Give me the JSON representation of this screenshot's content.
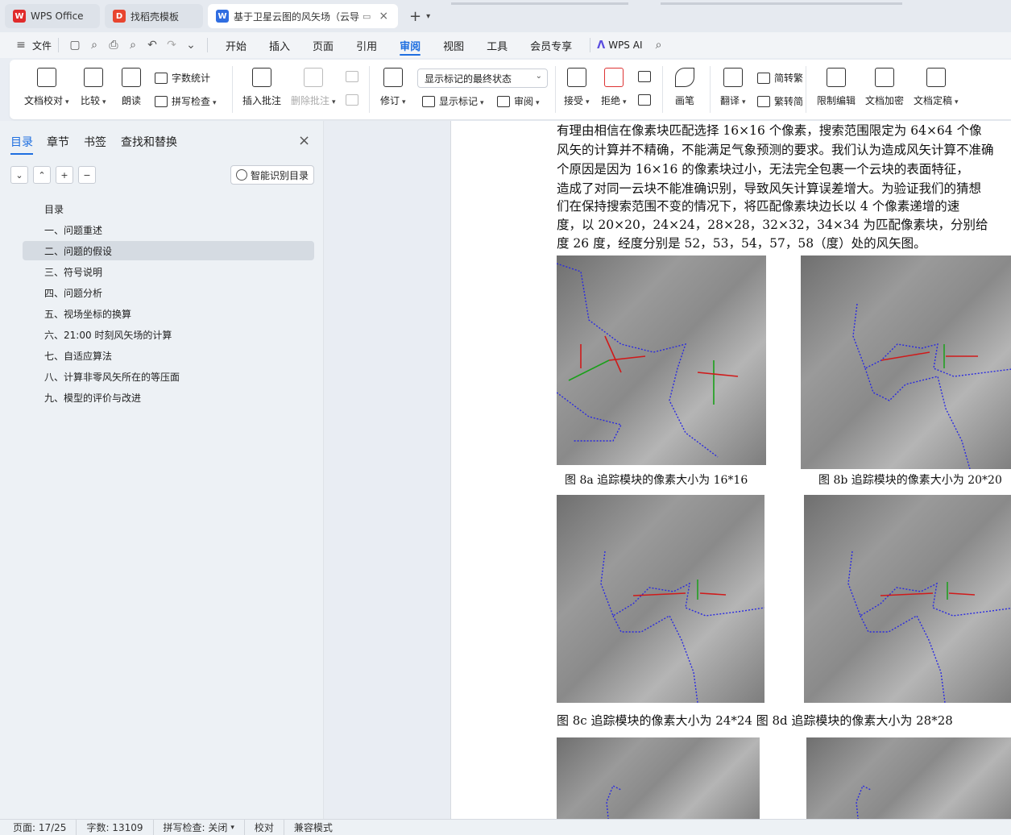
{
  "tabs": [
    {
      "label": "WPS Office",
      "icon": "wps-logo-icon",
      "color": "#e02b2b"
    },
    {
      "label": "找稻壳模板",
      "icon": "docer-icon",
      "color": "#e8452f"
    },
    {
      "label": "基于卫星云图的风矢场（云导",
      "icon": "word-doc-icon",
      "color": "#2f6de1"
    }
  ],
  "menu": {
    "file": "文件",
    "items": [
      "开始",
      "插入",
      "页面",
      "引用",
      "审阅",
      "视图",
      "工具",
      "会员专享"
    ],
    "active": "审阅",
    "wps_ai": "WPS AI"
  },
  "ribbon": {
    "doc_check": "文档校对",
    "compare": "比较",
    "read_aloud": "朗读",
    "word_count": "字数统计",
    "spell_check": "拼写检查",
    "insert_comment": "插入批注",
    "delete_comment": "删除批注",
    "revise": "修订",
    "markup_select": "显示标记的最终状态",
    "show_markup": "显示标记",
    "review": "审阅",
    "accept": "接受",
    "reject": "拒绝",
    "pen": "画笔",
    "translate": "翻译",
    "to_traditional": "简转繁",
    "to_simplified": "繁转简",
    "restrict_edit": "限制编辑",
    "encrypt": "文档加密",
    "finalize": "文档定稿"
  },
  "nav": {
    "tabs": [
      "目录",
      "章节",
      "书签",
      "查找和替换"
    ],
    "smart_toc": "智能识别目录",
    "toc": [
      "目录",
      "一、问题重述",
      "二、问题的假设",
      "三、符号说明",
      "四、问题分析",
      "五、视场坐标的换算",
      "六、21:00 时刻风矢场的计算",
      "七、自适应算法",
      "八、计算非零风矢所在的等压面",
      "九、模型的评价与改进"
    ],
    "selected_index": 2
  },
  "document": {
    "lines": [
      "有理由相信在像素块匹配选择 16×16 个像素，搜索范围限定为 64×64 个像",
      "风矢的计算并不精确，不能满足气象预测的要求。我们认为造成风矢计算不准确",
      "个原因是因为 16×16 的像素块过小，无法完全包裹一个云块的表面特征，",
      "造成了对同一云块不能准确识别，导致风矢计算误差增大。为验证我们的猜想",
      "们在保持搜索范围不变的情况下，将匹配像素块边长以 4 个像素递增的速",
      "度，以 20×20，24×24，28×28，32×32，34×34 为匹配像素块，分别给",
      "度 26 度，经度分别是 52，53，54，57，58（度）处的风矢图。"
    ],
    "captions": [
      "图 8a  追踪模块的像素大小为 16*16",
      "图 8b 追踪模块的像素大小为 20*20",
      "图  8c 追踪模块的像素大小为  24*24 图  8d 追踪模块的像素大小为  28*28"
    ]
  },
  "status": {
    "page": "页面: 17/25",
    "words": "字数: 13109",
    "spell": "拼写检查: 关闭",
    "proof": "校对",
    "compat": "兼容模式"
  }
}
